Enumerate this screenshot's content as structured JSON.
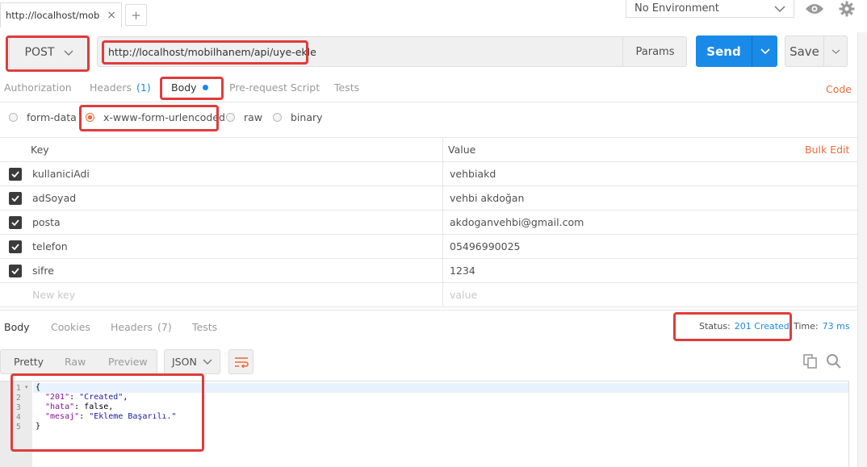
{
  "tabbar": {
    "tab_title": "http://localhost/mobil",
    "close_glyph": "×",
    "add_glyph": "+"
  },
  "environment": {
    "selected": "No Environment"
  },
  "request": {
    "method": "POST",
    "url": "http://localhost/mobilhanem/api/uye-ekle",
    "params_label": "Params",
    "send_label": "Send",
    "save_label": "Save"
  },
  "request_tabs": [
    {
      "label": "Authorization"
    },
    {
      "label": "Headers",
      "count": "(1)"
    },
    {
      "label": "Body"
    },
    {
      "label": "Pre-request Script"
    },
    {
      "label": "Tests"
    }
  ],
  "code_link": "Code",
  "body_modes": [
    {
      "label": "form-data",
      "checked": false
    },
    {
      "label": "x-www-form-urlencoded",
      "checked": true
    },
    {
      "label": "raw",
      "checked": false
    },
    {
      "label": "binary",
      "checked": false
    }
  ],
  "kv_table": {
    "key_header": "Key",
    "value_header": "Value",
    "bulk_edit": "Bulk Edit",
    "rows": [
      {
        "key": "kullaniciAdi",
        "value": "vehbiakd"
      },
      {
        "key": "adSoyad",
        "value": "vehbi akdoğan"
      },
      {
        "key": "posta",
        "value": "akdoganvehbi@gmail.com"
      },
      {
        "key": "telefon",
        "value": "05496990025"
      },
      {
        "key": "sifre",
        "value": "1234"
      }
    ],
    "new_key_placeholder": "New key",
    "new_value_placeholder": "value"
  },
  "response_tabs": [
    {
      "label": "Body"
    },
    {
      "label": "Cookies"
    },
    {
      "label": "Headers",
      "count": "(7)"
    },
    {
      "label": "Tests"
    }
  ],
  "status": {
    "label": "Status:",
    "value": "201 Created",
    "time_label": "Time:",
    "time_value": "73 ms"
  },
  "response_toolbar": {
    "pretty": "Pretty",
    "raw": "Raw",
    "preview": "Preview",
    "format": "JSON"
  },
  "response_body": {
    "line_numbers": [
      "1",
      "2",
      "3",
      "4",
      "5"
    ],
    "open_brace": "{",
    "close_brace": "}",
    "fields": [
      {
        "key": "\"201\"",
        "value": "\"Created\"",
        "sep": ","
      },
      {
        "key": "\"hata\"",
        "value": "false",
        "sep": ","
      },
      {
        "key": "\"mesaj\"",
        "value": "\"Ekleme Başarılı.\"",
        "sep": ""
      }
    ]
  },
  "colors": {
    "accent_blue": "#1a8ae8",
    "accent_orange": "#f26b3a",
    "annotation_red": "#e03b3b"
  },
  "icons": [
    "close-icon",
    "plus-icon",
    "chevron-down-icon",
    "eye-icon",
    "gear-icon",
    "wrap-icon",
    "copy-icon",
    "search-icon",
    "check-icon"
  ]
}
